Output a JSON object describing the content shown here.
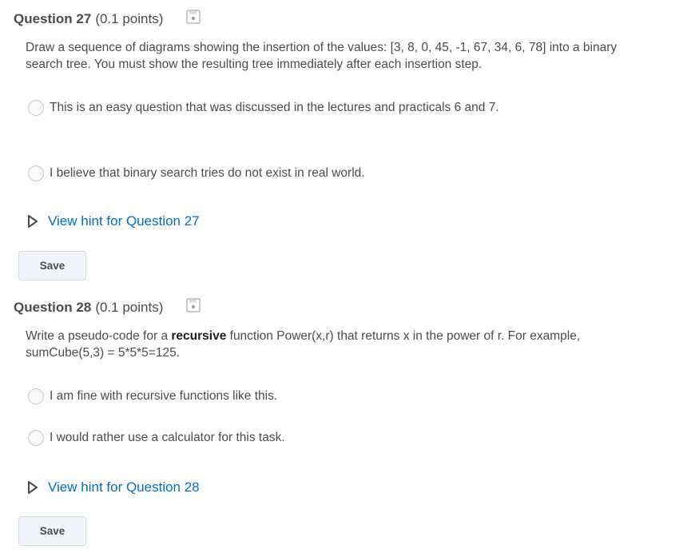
{
  "questions": [
    {
      "title": "Question 27",
      "points": "(0.1 points)",
      "prompt_before": "Draw a sequence of diagrams showing the insertion of the values: [3, 8, 0, 45, -1, 67, 34, 6, 78] into a binary search tree. You must show the resulting tree immediately after each insertion step.",
      "prompt_bold": "",
      "prompt_after": "",
      "options": [
        "This is an easy question that was discussed in the lectures and practicals 6 and 7.",
        "I believe that binary search tries do not exist in real world."
      ],
      "hint_label": "View hint for Question 27",
      "save_label": "Save",
      "icons": {
        "save_state": "floppy-disk-icon",
        "hint": "triangle-right-icon"
      }
    },
    {
      "title": "Question 28",
      "points": "(0.1 points)",
      "prompt_before": "Write a pseudo-code for a ",
      "prompt_bold": "recursive",
      "prompt_after": " function Power(x,r) that returns x in the power of r. For example, sumCube(5,3) = 5*5*5=125.",
      "options": [
        "I am fine with recursive functions like this.",
        "I would rather use a calculator for this task."
      ],
      "hint_label": "View hint for Question 28",
      "save_label": "Save",
      "icons": {
        "save_state": "floppy-disk-icon",
        "hint": "triangle-right-icon"
      }
    }
  ],
  "colors": {
    "text": "#494c4e",
    "link": "#006fbf",
    "button_bg": "#f1f5fb",
    "button_border": "#d3d9e3",
    "radio_border": "#c8cacc"
  }
}
